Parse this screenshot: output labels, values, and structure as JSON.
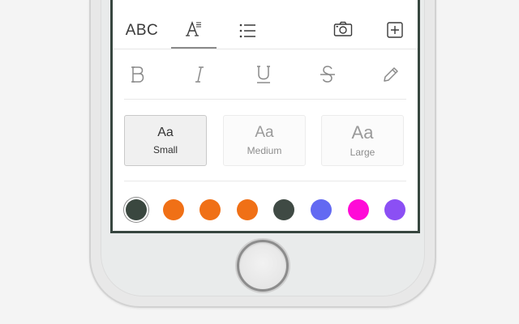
{
  "toolbar": {
    "abc_label": "ABC",
    "tabs": [
      {
        "name": "text-case",
        "label": "ABC"
      },
      {
        "name": "text-format",
        "icon": "text-format-icon",
        "selected": true
      },
      {
        "name": "checklist",
        "icon": "checklist-icon"
      },
      {
        "name": "camera",
        "icon": "camera-icon"
      },
      {
        "name": "add",
        "icon": "add-square-icon"
      }
    ]
  },
  "text_styles": [
    {
      "name": "bold",
      "icon": "bold-icon"
    },
    {
      "name": "italic",
      "icon": "italic-icon"
    },
    {
      "name": "underline",
      "icon": "underline-icon"
    },
    {
      "name": "strikethrough",
      "icon": "strikethrough-icon"
    },
    {
      "name": "pencil",
      "icon": "pencil-icon"
    }
  ],
  "text_sizes": {
    "small": {
      "sample": "Aa",
      "label": "Small",
      "selected": true
    },
    "medium": {
      "sample": "Aa",
      "label": "Medium",
      "selected": false
    },
    "large": {
      "sample": "Aa",
      "label": "Large",
      "selected": false
    }
  },
  "colors": [
    "#3a473f",
    "#f07016",
    "#f07016",
    "#f07016",
    "#3f4a44",
    "#6269f2",
    "#ff0ad7",
    "#8b4ff4"
  ],
  "selected_color_index": 0
}
